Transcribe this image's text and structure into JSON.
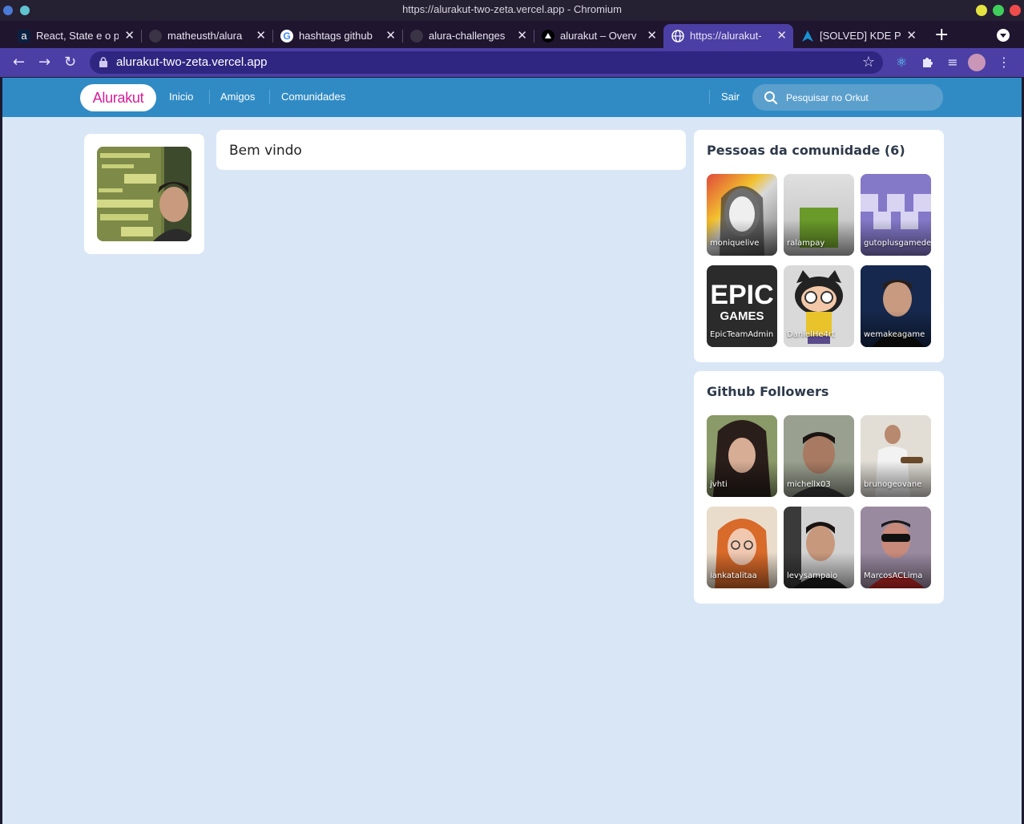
{
  "window": {
    "title": "https://alurakut-two-zeta.vercel.app - Chromium",
    "colors": {
      "minimize": "#e5e340",
      "maximize": "#3fcf5c",
      "close": "#ef4c4c"
    }
  },
  "tabs": [
    {
      "label": "React, State e o p",
      "icon": "alura-icon"
    },
    {
      "label": "matheusth/alura",
      "icon": "github-icon"
    },
    {
      "label": "hashtags github",
      "icon": "google-icon"
    },
    {
      "label": "alura-challenges",
      "icon": "github-icon"
    },
    {
      "label": "alurakut – Overv",
      "icon": "vercel-icon"
    },
    {
      "label": "https://alurakut-",
      "icon": "globe-icon",
      "active": true
    },
    {
      "label": "[SOLVED] KDE Pl",
      "icon": "arch-icon"
    }
  ],
  "toolbar": {
    "url": "alurakut-two-zeta.vercel.app"
  },
  "site": {
    "logo": "Alurakut",
    "nav": [
      "Inicio",
      "Amigos",
      "Comunidades"
    ],
    "logout": "Sair",
    "search_placeholder": "Pesquisar no Orkut",
    "colors": {
      "header": "#308bc5",
      "background": "#d9e6f6",
      "logo": "#d81d99"
    }
  },
  "welcome": "Bem vindo",
  "community": {
    "title": "Pessoas da comunidade (6)",
    "people": [
      "moniquelive",
      "ralampay",
      "gutoplusgamedev",
      "EpicTeamAdmin",
      "DanielHe4rt",
      "wemakeagame"
    ]
  },
  "followers": {
    "title": "Github Followers",
    "people": [
      "jvhti",
      "michellx03",
      "brunogeovane",
      "iankatalitaa",
      "levysampaio",
      "MarcosACLima"
    ]
  }
}
